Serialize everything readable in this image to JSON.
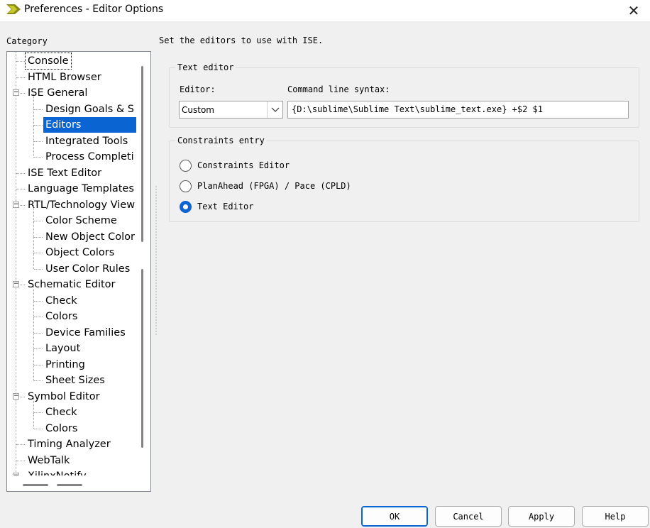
{
  "window": {
    "title": "Preferences - Editor Options",
    "close_icon": "close-icon",
    "app_icon": "xilinx-ise-icon"
  },
  "category": {
    "label": "Category",
    "items": [
      {
        "label": "Console",
        "focused": true
      },
      {
        "label": "HTML Browser"
      },
      {
        "label": "ISE General",
        "expanded": true
      },
      {
        "label": "Design Goals & S"
      },
      {
        "label": "Editors",
        "selected": true
      },
      {
        "label": "Integrated Tools"
      },
      {
        "label": "Process Completi"
      },
      {
        "label": "ISE Text Editor"
      },
      {
        "label": "Language Templates"
      },
      {
        "label": "RTL/Technology View",
        "expanded": true
      },
      {
        "label": "Color Scheme"
      },
      {
        "label": "New Object Color"
      },
      {
        "label": "Object Colors"
      },
      {
        "label": "User Color Rules"
      },
      {
        "label": "Schematic Editor",
        "expanded": true
      },
      {
        "label": "Check"
      },
      {
        "label": "Colors"
      },
      {
        "label": "Device Families"
      },
      {
        "label": "Layout"
      },
      {
        "label": "Printing"
      },
      {
        "label": "Sheet Sizes"
      },
      {
        "label": "Symbol Editor",
        "expanded": true
      },
      {
        "label": "Check"
      },
      {
        "label": "Colors"
      },
      {
        "label": "Timing Analyzer"
      },
      {
        "label": "WebTalk"
      },
      {
        "label": "XilinxNotify",
        "expanded": true
      }
    ]
  },
  "main": {
    "description": "Set the editors to use with ISE.",
    "text_editor_group": {
      "title": "Text editor",
      "editor_label": "Editor:",
      "editor_value": "Custom",
      "cmd_label": "Command line syntax:",
      "cmd_value": "{D:\\sublime\\Sublime Text\\sublime_text.exe} +$2 $1"
    },
    "constraints_group": {
      "title": "Constraints entry",
      "options": [
        {
          "label": "Constraints Editor",
          "checked": false
        },
        {
          "label": "PlanAhead (FPGA) / Pace (CPLD)",
          "checked": false
        },
        {
          "label": "Text Editor",
          "checked": true
        }
      ]
    }
  },
  "buttons": {
    "ok": "OK",
    "cancel": "Cancel",
    "apply": "Apply",
    "help": "Help"
  },
  "colors": {
    "selection": "#0a64d2",
    "background": "#f0f0f0"
  }
}
